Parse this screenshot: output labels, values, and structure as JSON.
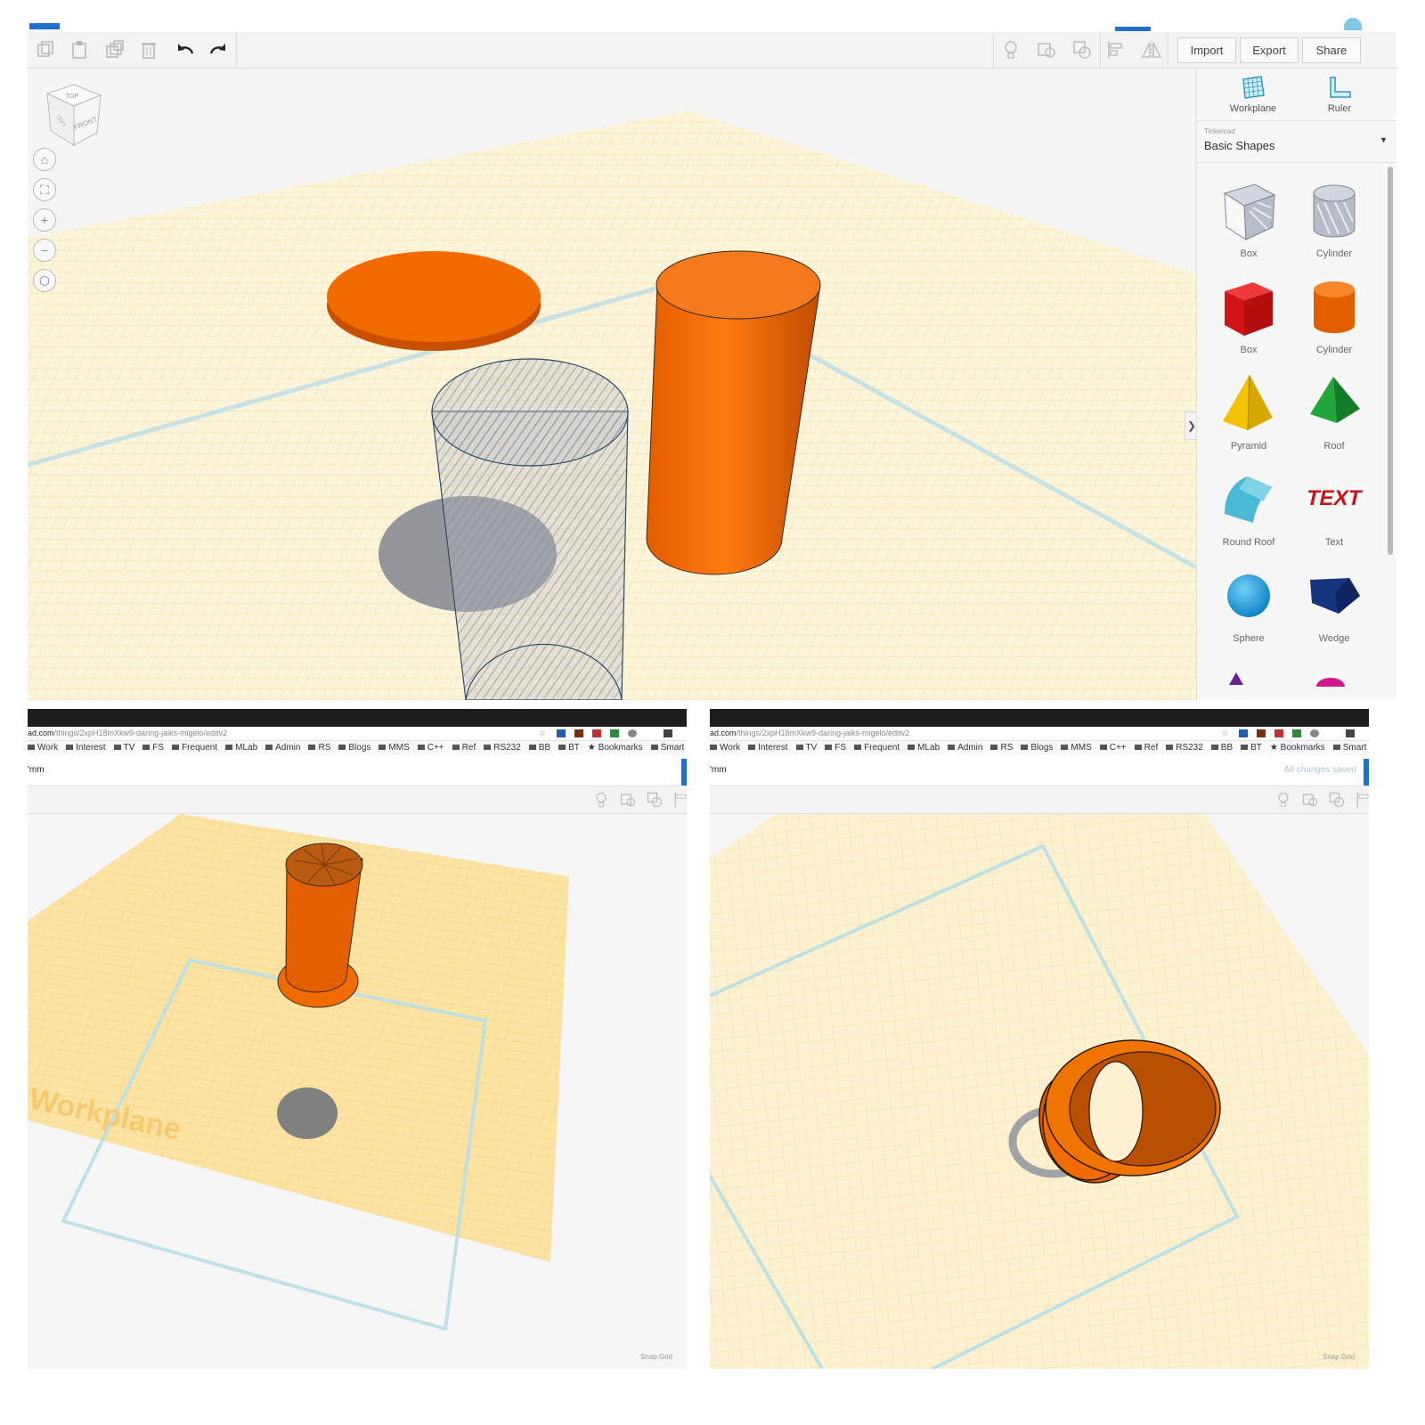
{
  "top": {
    "toolbar": {
      "import_label": "Import",
      "export_label": "Export",
      "share_label": "Share"
    },
    "view_cube": {
      "top_label": "TOP",
      "front_label": "FRONT",
      "left_label": "LEFT"
    },
    "sidebar": {
      "workplane_label": "Workplane",
      "ruler_label": "Ruler",
      "library_brand": "Tinkercad",
      "library_name": "Basic Shapes",
      "shapes": [
        {
          "label": "Box",
          "icon": "box-hole-icon"
        },
        {
          "label": "Cylinder",
          "icon": "cylinder-hole-icon"
        },
        {
          "label": "Box",
          "icon": "box-icon"
        },
        {
          "label": "Cylinder",
          "icon": "cylinder-icon"
        },
        {
          "label": "Pyramid",
          "icon": "pyramid-icon"
        },
        {
          "label": "Roof",
          "icon": "roof-icon"
        },
        {
          "label": "Round Roof",
          "icon": "round-roof-icon"
        },
        {
          "label": "Text",
          "icon": "text-shape-icon"
        },
        {
          "label": "Sphere",
          "icon": "sphere-icon"
        },
        {
          "label": "Wedge",
          "icon": "wedge-icon"
        }
      ],
      "text_shape_glyphs": "TEXT"
    },
    "collapse_glyph": "❯"
  },
  "browser": {
    "url_host": "ad.com",
    "url_path": "/things/2xpH18mXkw9-daring-jaiks-migelo/editv2",
    "bookmarks": [
      "Work",
      "Interest",
      "TV",
      "FS",
      "Frequent",
      "MLab",
      "Admin",
      "RS",
      "Blogs",
      "MMS",
      "C++",
      "Ref",
      "RS232",
      "BB",
      "BT"
    ],
    "bookmarks_star": "★ Bookmarks",
    "smart_bookmarks": "Smart Bookm",
    "unit_text": "'mm",
    "saved_text": "All changes saved",
    "snap_label": "Snap Grid",
    "workplane_watermark": "Workplane"
  },
  "colors": {
    "orange": "#f26b00",
    "orange_dark": "#c84f00",
    "grid": "#fbe3a4",
    "workplane_outline": "#b9dfe6",
    "accent_blue": "#1e6fd0"
  }
}
